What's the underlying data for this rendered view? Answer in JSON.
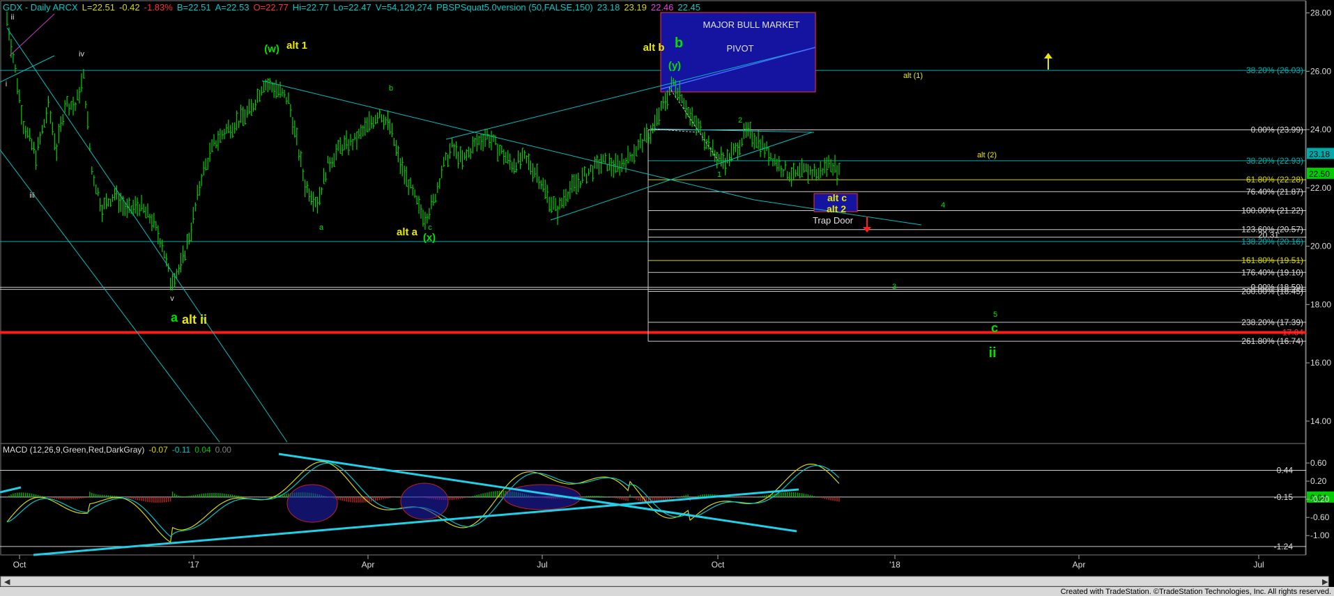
{
  "header": {
    "segments": [
      {
        "text": "GDX - Daily  ARCX",
        "color": "#00c8c8"
      },
      {
        "text": "L=22.51",
        "color": "#d8d800"
      },
      {
        "text": "-0.42",
        "color": "#d8d800"
      },
      {
        "text": "-1.83%",
        "color": "#ff3030"
      },
      {
        "text": "B=22.51",
        "color": "#00c8c8"
      },
      {
        "text": "A=22.53",
        "color": "#00c8c8"
      },
      {
        "text": "O=22.77",
        "color": "#ff3030"
      },
      {
        "text": "Hi=22.77",
        "color": "#00c8c8"
      },
      {
        "text": "Lo=22.47",
        "color": "#00c8c8"
      },
      {
        "text": "V=54,129,274",
        "color": "#00c8c8"
      },
      {
        "text": "PBSPSquat5.0version (50,FALSE,150)",
        "color": "#00c8c8"
      },
      {
        "text": "23.18",
        "color": "#00c8c8"
      },
      {
        "text": "23.19",
        "color": "#d8d800"
      },
      {
        "text": "22.46",
        "color": "#e040e0"
      },
      {
        "text": "22.45",
        "color": "#00c8c8"
      }
    ]
  },
  "macd_header": {
    "segments": [
      {
        "text": "MACD (12,26,9,Green,Red,DarkGray)",
        "color": "#dddddd"
      },
      {
        "text": "-0.07",
        "color": "#d8d800"
      },
      {
        "text": "-0.11",
        "color": "#00c8c8"
      },
      {
        "text": "0.04",
        "color": "#00c000"
      },
      {
        "text": "0.00",
        "color": "#808080"
      }
    ]
  },
  "footer": "Created with TradeStation. ©TradeStation Technologies, Inc. All rights reserved.",
  "price_axis_ticks": [
    "28.00",
    "26.00",
    "24.00",
    "22.00",
    "20.00",
    "18.00",
    "16.00",
    "14.00"
  ],
  "macd_axis_ticks": [
    "0.60",
    "0.20",
    "-0.20",
    "-0.60",
    "-1.00"
  ],
  "x_axis_ticks": [
    "Oct",
    "'17",
    "Apr",
    "Jul",
    "Oct",
    "'18",
    "Apr",
    "Jul"
  ],
  "price_flags": [
    {
      "text": "23.18",
      "bg": "#00aaaa",
      "fg": "#000000"
    },
    {
      "text": "22.50",
      "bg": "#00cc00",
      "fg": "#000000"
    }
  ],
  "macd_flags": [
    {
      "text": "0.04",
      "bg": "#00cc00",
      "fg": "#000000"
    }
  ],
  "macd_labels": [
    "0.44",
    "-0.15",
    "-1.24"
  ],
  "fib_levels": [
    {
      "label": "38.20% (26.03)",
      "color": "#00b0b0"
    },
    {
      "label": "0.00% (23.99)",
      "color": "#dddddd"
    },
    {
      "label": "38.20% (22.93)",
      "color": "#00b0b0"
    },
    {
      "label": "61.80% (22.28)",
      "color": "#d8d800"
    },
    {
      "label": "76.40% (21.87)",
      "color": "#dddddd"
    },
    {
      "label": "100.00% (21.22)",
      "color": "#dddddd"
    },
    {
      "label": "123.60% (20.57)",
      "color": "#dddddd"
    },
    {
      "label": "20.31",
      "color": "#dddddd"
    },
    {
      "label": "138.20% (20.16)",
      "color": "#00b0b0"
    },
    {
      "label": "161.80% (19.51)",
      "color": "#d8d800"
    },
    {
      "label": "176.40% (19.10)",
      "color": "#dddddd"
    },
    {
      "label": "0.00% (18.59)",
      "color": "#dddddd"
    },
    {
      "label": "200.00% (18.45)",
      "color": "#dddddd"
    },
    {
      "label": "238.20% (17.39)",
      "color": "#dddddd"
    },
    {
      "label": "17.04",
      "color": "#ff3030"
    },
    {
      "label": "261.80% (16.74)",
      "color": "#dddddd"
    }
  ],
  "boxes": {
    "bull_title": "MAJOR BULL MARKET",
    "bull_pivot": "PIVOT",
    "trap_door": "Trap Door"
  },
  "wave_labels": [
    {
      "text": "ii",
      "color": "#dddddd",
      "size": 11,
      "bold": false
    },
    {
      "text": "i",
      "color": "#dddddd",
      "size": 11,
      "bold": false
    },
    {
      "text": "iii",
      "color": "#dddddd",
      "size": 11,
      "bold": false
    },
    {
      "text": "iv",
      "color": "#dddddd",
      "size": 11,
      "bold": false
    },
    {
      "text": "v",
      "color": "#dddddd",
      "size": 11,
      "bold": false
    },
    {
      "text": "a",
      "color": "#00e000",
      "size": 18,
      "bold": true
    },
    {
      "text": "alt ii",
      "color": "#e8e800",
      "size": 18,
      "bold": true
    },
    {
      "text": "(w)",
      "color": "#00e000",
      "size": 15,
      "bold": true
    },
    {
      "text": "alt 1",
      "color": "#e8e800",
      "size": 15,
      "bold": true
    },
    {
      "text": "a",
      "color": "#00e000",
      "size": 11,
      "bold": false
    },
    {
      "text": "b",
      "color": "#00e000",
      "size": 11,
      "bold": false
    },
    {
      "text": "c",
      "color": "#00e000",
      "size": 11,
      "bold": false
    },
    {
      "text": "alt a",
      "color": "#e8e800",
      "size": 15,
      "bold": true
    },
    {
      "text": "(x)",
      "color": "#00e000",
      "size": 15,
      "bold": true
    },
    {
      "text": "alt b",
      "color": "#e8e800",
      "size": 15,
      "bold": true
    },
    {
      "text": "b",
      "color": "#00e000",
      "size": 20,
      "bold": true
    },
    {
      "text": "(y)",
      "color": "#00e000",
      "size": 15,
      "bold": true
    },
    {
      "text": "2",
      "color": "#00e000",
      "size": 11,
      "bold": false
    },
    {
      "text": "1",
      "color": "#00e000",
      "size": 11,
      "bold": false
    },
    {
      "text": "alt c",
      "color": "#e8e800",
      "size": 14,
      "bold": true
    },
    {
      "text": "alt 2",
      "color": "#e8e800",
      "size": 14,
      "bold": true
    },
    {
      "text": "4",
      "color": "#00e000",
      "size": 11,
      "bold": false
    },
    {
      "text": "3",
      "color": "#00e000",
      "size": 11,
      "bold": false
    },
    {
      "text": "5",
      "color": "#00e000",
      "size": 11,
      "bold": false
    },
    {
      "text": "c",
      "color": "#00e000",
      "size": 18,
      "bold": true
    },
    {
      "text": "ii",
      "color": "#00e000",
      "size": 20,
      "bold": true
    },
    {
      "text": "alt (1)",
      "color": "#e8e800",
      "size": 11,
      "bold": false
    },
    {
      "text": "alt (2)",
      "color": "#e8e800",
      "size": 11,
      "bold": false
    }
  ],
  "chart_data": {
    "type": "candlestick",
    "symbol": "GDX",
    "ylim": [
      13.4,
      28.3
    ],
    "macd_ylim": [
      -1.35,
      0.8
    ],
    "price_anchors": [
      {
        "t": 0,
        "v": 27.8
      },
      {
        "t": 3,
        "v": 26.5
      },
      {
        "t": 8,
        "v": 24.2
      },
      {
        "t": 14,
        "v": 23.1
      },
      {
        "t": 20,
        "v": 24.8
      },
      {
        "t": 24,
        "v": 23.3
      },
      {
        "t": 28,
        "v": 24.9
      },
      {
        "t": 33,
        "v": 24.8
      },
      {
        "t": 37,
        "v": 25.8
      },
      {
        "t": 41,
        "v": 22.6
      },
      {
        "t": 46,
        "v": 21.3
      },
      {
        "t": 52,
        "v": 21.8
      },
      {
        "t": 58,
        "v": 21.2
      },
      {
        "t": 64,
        "v": 21.4
      },
      {
        "t": 70,
        "v": 20.9
      },
      {
        "t": 75,
        "v": 20.1
      },
      {
        "t": 79,
        "v": 18.8
      },
      {
        "t": 84,
        "v": 19.3
      },
      {
        "t": 89,
        "v": 20.6
      },
      {
        "t": 94,
        "v": 22.4
      },
      {
        "t": 100,
        "v": 23.5
      },
      {
        "t": 106,
        "v": 24.0
      },
      {
        "t": 112,
        "v": 24.3
      },
      {
        "t": 118,
        "v": 24.7
      },
      {
        "t": 124,
        "v": 25.6
      },
      {
        "t": 130,
        "v": 25.4
      },
      {
        "t": 136,
        "v": 25.0
      },
      {
        "t": 140,
        "v": 23.6
      },
      {
        "t": 144,
        "v": 22.1
      },
      {
        "t": 150,
        "v": 21.5
      },
      {
        "t": 155,
        "v": 22.8
      },
      {
        "t": 161,
        "v": 23.4
      },
      {
        "t": 168,
        "v": 23.6
      },
      {
        "t": 174,
        "v": 24.1
      },
      {
        "t": 180,
        "v": 24.6
      },
      {
        "t": 185,
        "v": 24.1
      },
      {
        "t": 190,
        "v": 22.8
      },
      {
        "t": 195,
        "v": 22.0
      },
      {
        "t": 199,
        "v": 21.3
      },
      {
        "t": 202,
        "v": 21.0
      },
      {
        "t": 206,
        "v": 21.5
      },
      {
        "t": 210,
        "v": 22.6
      },
      {
        "t": 215,
        "v": 23.4
      },
      {
        "t": 220,
        "v": 22.9
      },
      {
        "t": 226,
        "v": 23.5
      },
      {
        "t": 232,
        "v": 23.8
      },
      {
        "t": 238,
        "v": 23.3
      },
      {
        "t": 244,
        "v": 22.8
      },
      {
        "t": 250,
        "v": 23.0
      },
      {
        "t": 256,
        "v": 22.5
      },
      {
        "t": 262,
        "v": 21.6
      },
      {
        "t": 266,
        "v": 21.2
      },
      {
        "t": 270,
        "v": 21.8
      },
      {
        "t": 276,
        "v": 22.2
      },
      {
        "t": 282,
        "v": 22.6
      },
      {
        "t": 288,
        "v": 22.9
      },
      {
        "t": 294,
        "v": 22.7
      },
      {
        "t": 300,
        "v": 23.0
      },
      {
        "t": 306,
        "v": 23.5
      },
      {
        "t": 312,
        "v": 24.0
      },
      {
        "t": 318,
        "v": 25.0
      },
      {
        "t": 322,
        "v": 25.6
      },
      {
        "t": 326,
        "v": 25.2
      },
      {
        "t": 330,
        "v": 24.4
      },
      {
        "t": 336,
        "v": 23.9
      },
      {
        "t": 342,
        "v": 23.1
      },
      {
        "t": 347,
        "v": 22.9
      },
      {
        "t": 352,
        "v": 23.3
      },
      {
        "t": 357,
        "v": 23.9
      },
      {
        "t": 362,
        "v": 23.7
      },
      {
        "t": 368,
        "v": 23.2
      },
      {
        "t": 374,
        "v": 22.7
      },
      {
        "t": 380,
        "v": 22.4
      },
      {
        "t": 386,
        "v": 22.6
      },
      {
        "t": 392,
        "v": 22.5
      },
      {
        "t": 398,
        "v": 22.9
      },
      {
        "t": 402,
        "v": 22.5
      }
    ],
    "series": [
      {
        "name": "MACD",
        "color": "#d8d800"
      },
      {
        "name": "Signal",
        "color": "#00c8c8"
      },
      {
        "name": "Histogram",
        "color": "#00c000"
      }
    ]
  }
}
